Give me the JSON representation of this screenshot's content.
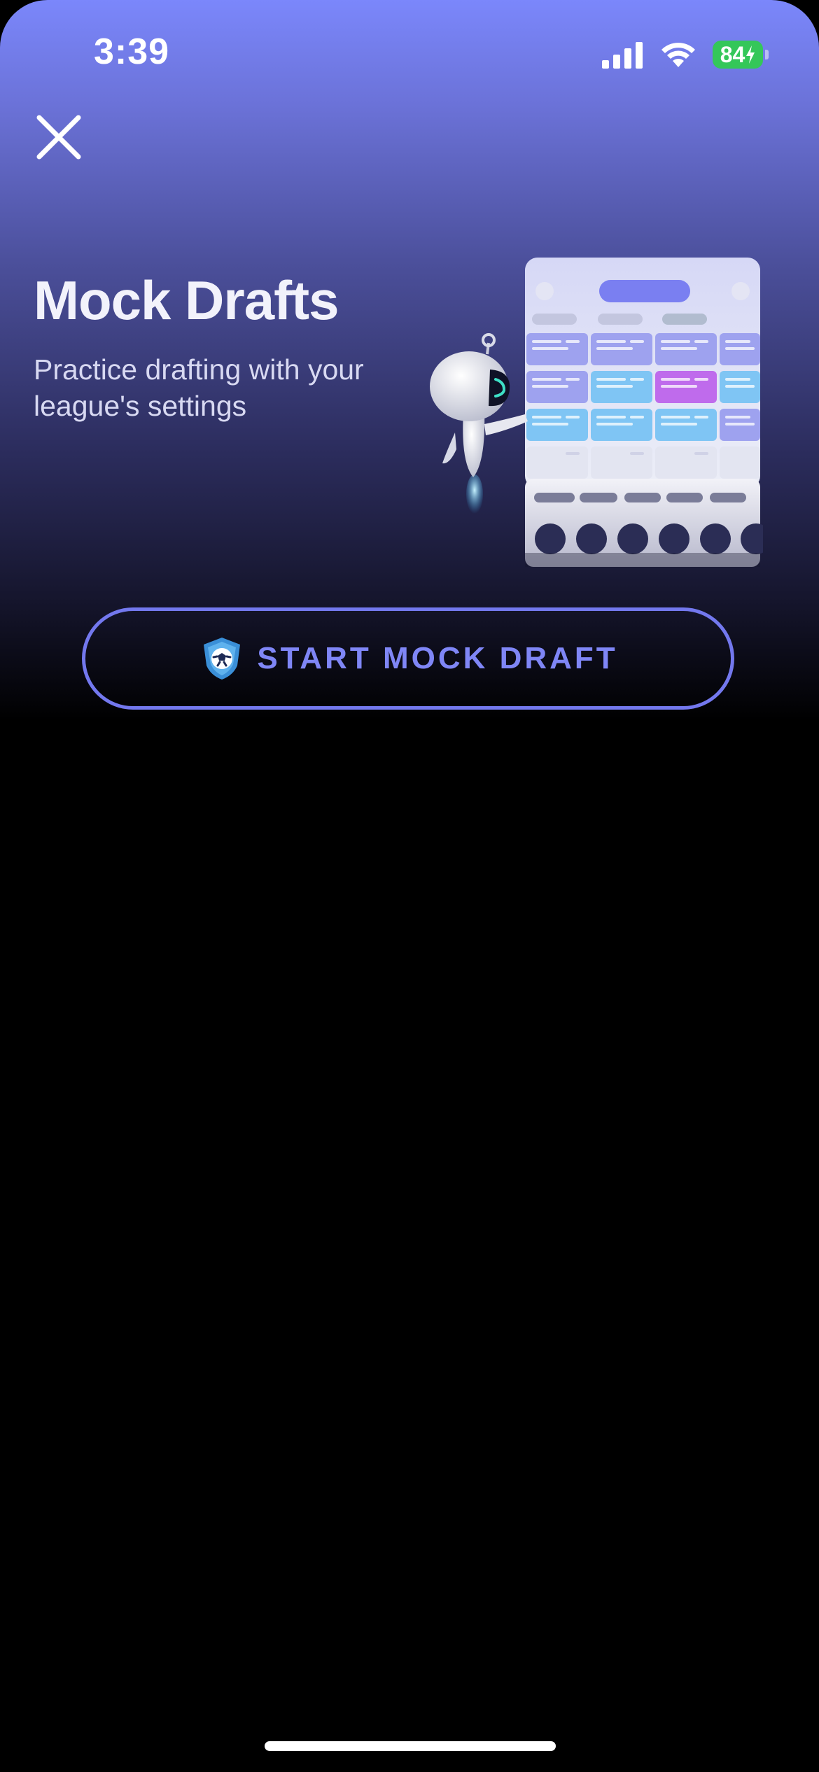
{
  "status_bar": {
    "time": "3:39",
    "battery": "84",
    "icons": [
      "cellular-signal-icon",
      "wifi-icon",
      "battery-charging-icon"
    ]
  },
  "header": {
    "close_icon": "close-icon"
  },
  "hero": {
    "title": "Mock Drafts",
    "subtitle": "Practice drafting with your league's settings",
    "illustration": "robot-draft-board-illustration"
  },
  "cta": {
    "label": "START MOCK DRAFT",
    "icon": "soccer-ball-shield-icon"
  },
  "colors": {
    "accent": "#7378ee",
    "accent_text": "#7f86f6",
    "battery_green": "#34c759",
    "background": "#000000",
    "gradient_top": "#7b87fb"
  }
}
